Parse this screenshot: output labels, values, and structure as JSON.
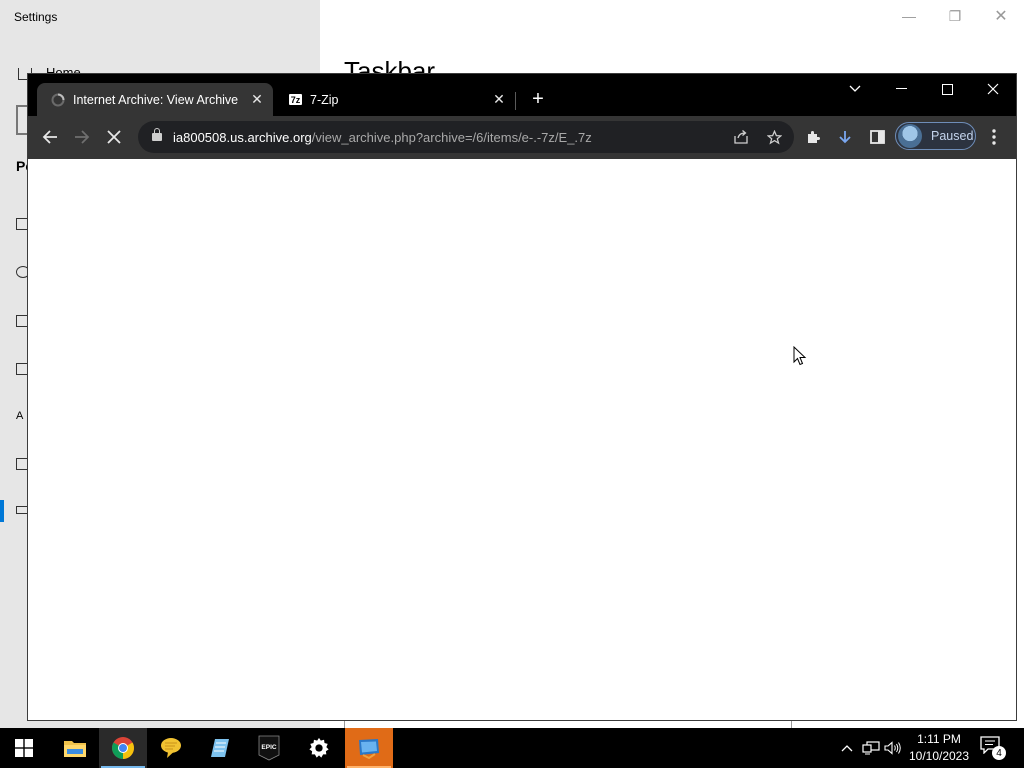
{
  "settings": {
    "title": "Settings",
    "home_label": "Home",
    "page_heading": "Taskbar",
    "section_partial": "Pe"
  },
  "chrome": {
    "tabs": [
      {
        "label": "Internet Archive: View Archive",
        "favicon": "loading-icon",
        "active": true
      },
      {
        "label": "7-Zip",
        "favicon": "7zip-icon",
        "active": false
      }
    ],
    "address": {
      "host": "ia800508.us.archive.org",
      "path": "/view_archive.php?archive=/6/items/e-.-7z/E_.7z"
    },
    "profile_label": "Paused",
    "loading": true
  },
  "taskbar": {
    "apps": [
      {
        "name": "start",
        "icon": "windows-icon"
      },
      {
        "name": "file-explorer",
        "icon": "folder-icon"
      },
      {
        "name": "chrome",
        "icon": "chrome-icon"
      },
      {
        "name": "chat",
        "icon": "speech-bubble-icon"
      },
      {
        "name": "notepad",
        "icon": "notepad-icon"
      },
      {
        "name": "epic-games",
        "icon": "epic-games-icon"
      },
      {
        "name": "settings",
        "icon": "gear-icon"
      },
      {
        "name": "app",
        "icon": "app-icon"
      }
    ],
    "epic_label": "EPIC",
    "clock_time": "1:11 PM",
    "clock_date": "10/10/2023",
    "notification_count": "4"
  }
}
